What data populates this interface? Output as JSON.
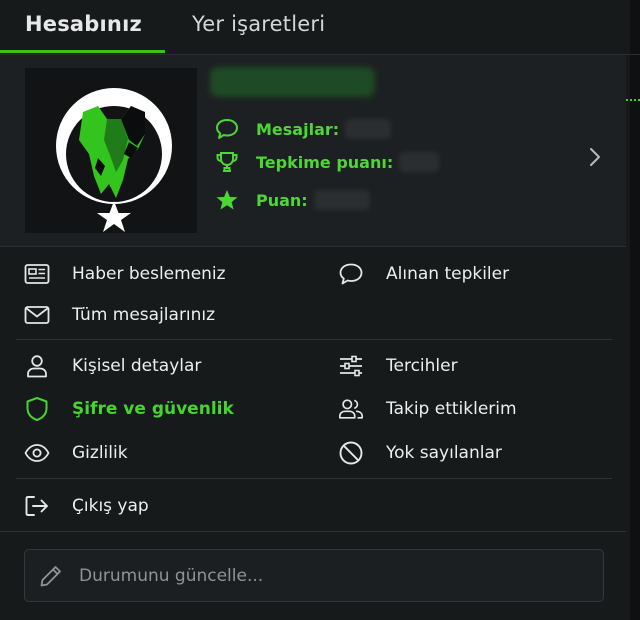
{
  "tabs": [
    {
      "label": "Hesabınız",
      "active": true
    },
    {
      "label": "Yer işaretleri",
      "active": false
    }
  ],
  "profile": {
    "stats": [
      {
        "icon": "speech-bubble-icon",
        "label": "Mesajlar:"
      },
      {
        "icon": "trophy-icon",
        "label": "Tepkime puanı:"
      },
      {
        "icon": "star-icon",
        "label": "Puan:"
      }
    ]
  },
  "menu": {
    "news_feed": "Haber beslemeniz",
    "reactions_received": "Alınan tepkiler",
    "all_messages": "Tüm mesajlarınız",
    "personal_details": "Kişisel detaylar",
    "preferences": "Tercihler",
    "password_security": "Şifre ve güvenlik",
    "following": "Takip ettiklerim",
    "privacy": "Gizlilik",
    "ignored": "Yok sayılanlar",
    "logout": "Çıkış yap"
  },
  "status": {
    "placeholder": "Durumunu güncelle..."
  },
  "colors": {
    "accent": "#35c51c",
    "background": "#171a1b",
    "card": "#1d2022"
  }
}
